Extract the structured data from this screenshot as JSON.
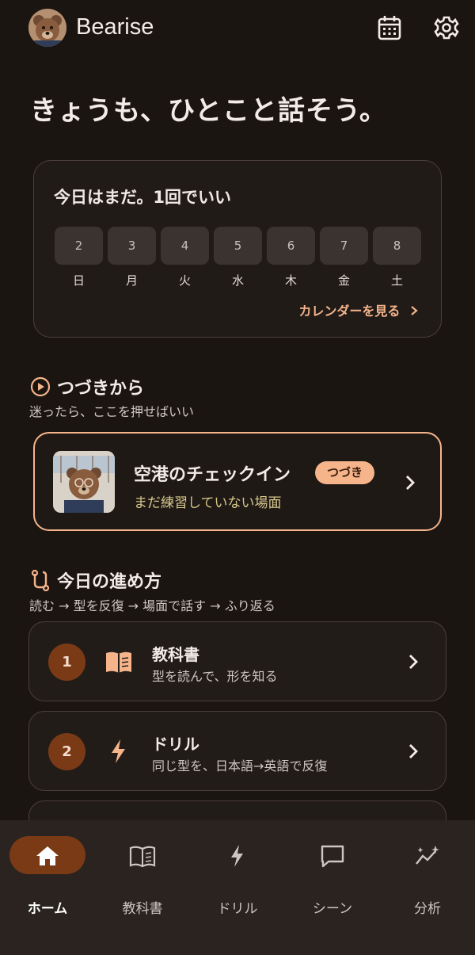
{
  "header": {
    "app_name": "Bearise",
    "calendar_icon": "calendar-icon",
    "settings_icon": "gear-icon"
  },
  "hero": {
    "title": "きょうも、ひとこと話そう。"
  },
  "today_card": {
    "title": "今日はまだ。1回でいい",
    "days": [
      {
        "num": "2",
        "label": "日"
      },
      {
        "num": "3",
        "label": "月"
      },
      {
        "num": "4",
        "label": "火"
      },
      {
        "num": "5",
        "label": "水"
      },
      {
        "num": "6",
        "label": "木"
      },
      {
        "num": "7",
        "label": "金"
      },
      {
        "num": "8",
        "label": "土"
      }
    ],
    "calendar_link": "カレンダーを見る"
  },
  "continue_section": {
    "title": "つづきから",
    "subtitle": "迷ったら、ここを押せばいい",
    "card": {
      "title": "空港のチェックイン",
      "badge": "つづき",
      "subtitle": "まだ練習していない場面"
    }
  },
  "plan_section": {
    "title": "今日の進め方",
    "subtitle": "読む → 型を反復 → 場面で話す → ふり返る",
    "steps": [
      {
        "num": "1",
        "title": "教科書",
        "subtitle": "型を読んで、形を知る",
        "icon": "book-icon"
      },
      {
        "num": "2",
        "title": "ドリル",
        "subtitle": "同じ型を、日本語→英語で反復",
        "icon": "bolt-icon"
      }
    ]
  },
  "bottom_nav": {
    "items": [
      {
        "label": "ホーム",
        "icon": "home-icon",
        "active": true
      },
      {
        "label": "教科書",
        "icon": "book-icon",
        "active": false
      },
      {
        "label": "ドリル",
        "icon": "bolt-icon",
        "active": false
      },
      {
        "label": "シーン",
        "icon": "chat-bubble-icon",
        "active": false
      },
      {
        "label": "分析",
        "icon": "analytics-icon",
        "active": false
      }
    ]
  },
  "colors": {
    "background": "#1b1512",
    "accent": "#f6b48b",
    "accent_dark": "#7a3a16",
    "subtitle_yellow": "#d6c78a"
  }
}
